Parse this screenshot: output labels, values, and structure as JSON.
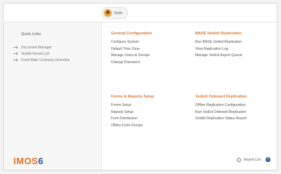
{
  "header": {
    "user_name": "Vedin"
  },
  "sidebar": {
    "title": "Quick Links",
    "items": [
      {
        "label": "Document Manager"
      },
      {
        "label": "Vedixit Vessel List"
      },
      {
        "label": "Fixed Rate Contracts Overview"
      }
    ]
  },
  "sections": {
    "general": {
      "title": "General Configuration",
      "links": [
        "Configure System",
        "Default Time Zone",
        "Manage Users & Groups",
        "Change Password"
      ]
    },
    "base": {
      "title": "BASE Vedixit Replication",
      "links": [
        "Run BASE Vedixit Replication",
        "View Replication Log",
        "Manage Vedixit Export Queue"
      ]
    },
    "forms": {
      "title": "Forms & Reports Setup",
      "links": [
        "Forms Setup",
        "Reports Setup",
        "Form Distribution",
        "Offline Form Groups"
      ]
    },
    "onboard": {
      "title": "Vedixit Onboard Replication",
      "links": [
        "Offline Replication Configuration",
        "Run Vedixit Onboard Replication",
        "Vedixit Replication Status Report"
      ]
    }
  },
  "logo": {
    "part1": "IMOS",
    "part2": "6"
  },
  "footer": {
    "report_label": "Report List"
  },
  "colors": {
    "accent": "#d9762e",
    "brand_blue": "#2a56a6"
  }
}
